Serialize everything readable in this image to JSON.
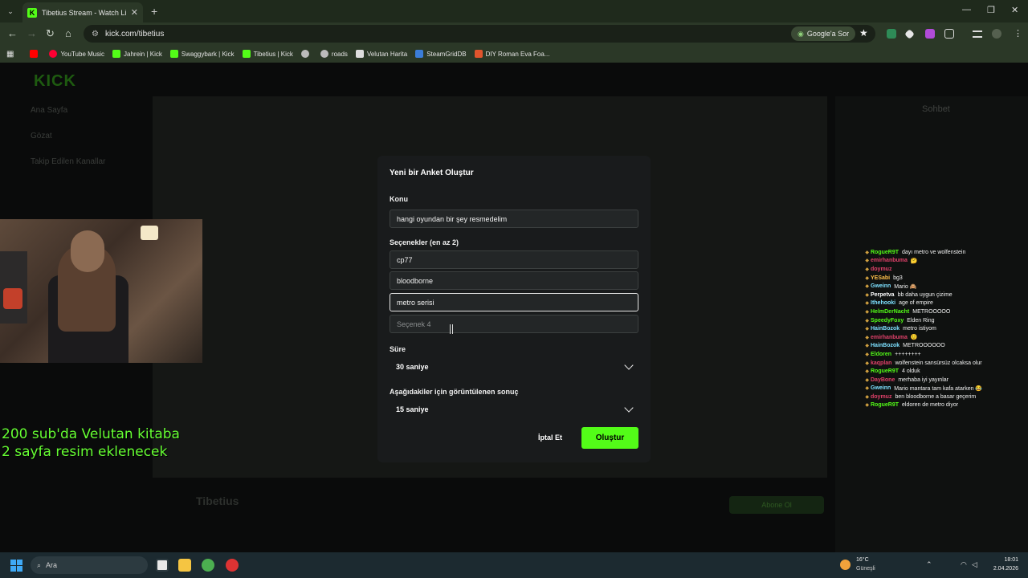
{
  "browser": {
    "tab_title": "Tibetius Stream - Watch Live o",
    "tab_favicon": "K",
    "new_tab": "+",
    "url": "kick.com/tibetius",
    "ask_google": "Google'a Sor",
    "bookmarks": [
      {
        "label": "",
        "icon": "youtube-icon",
        "color": "#ff0000"
      },
      {
        "label": "YouTube Music",
        "icon": "youtube-music-icon",
        "color": "#ff0033"
      },
      {
        "label": "Jahrein | Kick",
        "icon": "kick-icon",
        "color": "#53fc18"
      },
      {
        "label": "Swaggybark | Kick",
        "icon": "kick-icon",
        "color": "#53fc18"
      },
      {
        "label": "Tibetius | Kick",
        "icon": "kick-icon",
        "color": "#53fc18"
      },
      {
        "label": "",
        "icon": "globe-icon",
        "color": "#bbbbbb"
      },
      {
        "label": "roads",
        "icon": "globe-icon",
        "color": "#bbbbbb"
      },
      {
        "label": "Velutan Harita",
        "icon": "map-icon",
        "color": "#dddddd"
      },
      {
        "label": "SteamGridDB",
        "icon": "steamgrid-icon",
        "color": "#3b7dd8"
      },
      {
        "label": "DIY Roman Eva Foa...",
        "icon": "diy-icon",
        "color": "#e0542d"
      }
    ]
  },
  "page": {
    "logo": "KICK",
    "sidebar": [
      "Ana Sayfa",
      "Gözat",
      "Takip Edilen Kanallar"
    ],
    "chat_title": "Sohbet",
    "streamer": "Tibetius",
    "follow": "Abone Ol"
  },
  "overlay": {
    "line1": "200 sub'da Velutan kitaba",
    "line2": " 2 sayfa resim eklenecek"
  },
  "chat": [
    {
      "user": "RogueR9T",
      "color": "#53fc18",
      "msg": "dayı metro ve wolfenstein"
    },
    {
      "user": "emirhanbuma",
      "color": "#e0416a",
      "msg": "🤔"
    },
    {
      "user": "doymuz",
      "color": "#e0416a",
      "msg": ""
    },
    {
      "user": "YESabi",
      "color": "#ffc04a",
      "msg": "bg3"
    },
    {
      "user": "Gweinn",
      "color": "#7de0ff",
      "msg": "Mario 🙈"
    },
    {
      "user": "Perpetva",
      "color": "#ffffff",
      "msg": "bb daha uygun çizime"
    },
    {
      "user": "Ithehooki",
      "color": "#7de0ff",
      "msg": "age of empire"
    },
    {
      "user": "HelmDerNacht",
      "color": "#53fc18",
      "msg": "METROOOOO"
    },
    {
      "user": "SpeedyFoxy",
      "color": "#53fc18",
      "msg": "Elden Ring"
    },
    {
      "user": "HainBozok",
      "color": "#7de0ff",
      "msg": "metro istiyom"
    },
    {
      "user": "emirhanbuma",
      "color": "#e0416a",
      "msg": "🙂"
    },
    {
      "user": "HainBozok",
      "color": "#7de0ff",
      "msg": "METROOOOOO"
    },
    {
      "user": "Eldoren",
      "color": "#53fc18",
      "msg": "++++++++"
    },
    {
      "user": "kaqplan",
      "color": "#e0416a",
      "msg": "wolfenstein sansürsüz olcaksa olur"
    },
    {
      "user": "RogueR9T",
      "color": "#53fc18",
      "msg": "4 olduk"
    },
    {
      "user": "DayBone",
      "color": "#e0416a",
      "msg": "merhaba iyi yayınlar"
    },
    {
      "user": "Gweinn",
      "color": "#7de0ff",
      "msg": "Mario mantara tam kafa atarken 😂"
    },
    {
      "user": "doymuz",
      "color": "#e0416a",
      "msg": "ben bloodborne a basar geçerim"
    },
    {
      "user": "RogueR9T",
      "color": "#53fc18",
      "msg": "eldoren de metro diyor"
    }
  ],
  "modal": {
    "title": "Yeni bir Anket Oluştur",
    "topic_label": "Konu",
    "topic_value": "hangi oyundan bir şey resmedelim",
    "options_label": "Seçenekler (en az 2)",
    "options": [
      "cp77",
      "bloodborne",
      "metro serisi"
    ],
    "option4_placeholder": "Seçenek 4",
    "duration_label": "Süre",
    "duration_value": "30 saniye",
    "result_label": "Aşağıdakiler için görüntülenen sonuç",
    "result_value": "15 saniye",
    "cancel": "İptal Et",
    "create": "Oluştur",
    "accent": "#53fc18"
  },
  "taskbar": {
    "search": "Ara",
    "temp": "16°C",
    "weather": "Güneşli",
    "time": "18:01",
    "date": "2.04.2026"
  }
}
